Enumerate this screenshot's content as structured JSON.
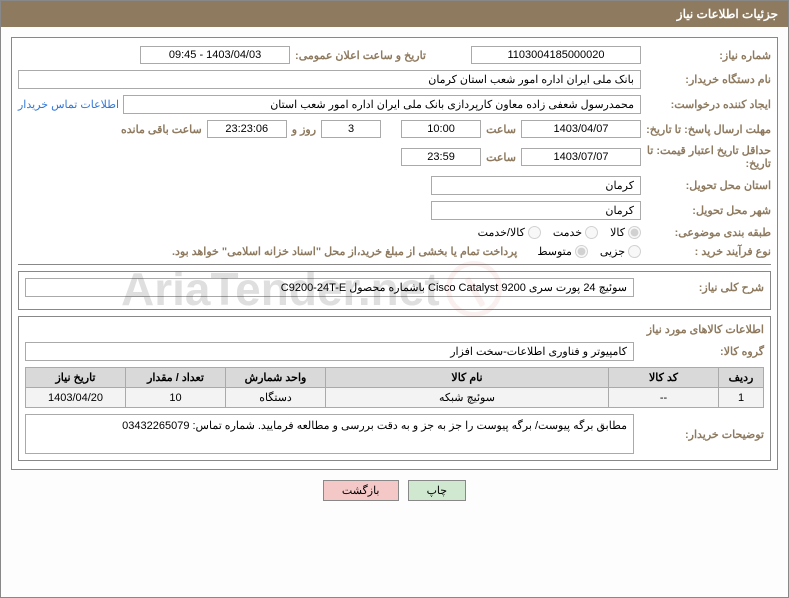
{
  "header": {
    "title": "جزئیات اطلاعات نیاز"
  },
  "fields": {
    "need_no_label": "شماره نیاز:",
    "need_no": "1103004185000020",
    "announce_dt_label": "تاریخ و ساعت اعلان عمومی:",
    "announce_dt": "1403/04/03 - 09:45",
    "buyer_org_label": "نام دستگاه خریدار:",
    "buyer_org": "بانک ملی ایران اداره امور شعب استان کرمان",
    "requester_label": "ایجاد کننده درخواست:",
    "requester": "محمدرسول شعفی زاده معاون کارپردازی بانک ملی ایران اداره امور شعب استان",
    "contact_link": "اطلاعات تماس خریدار",
    "resp_dead_label": "مهلت ارسال پاسخ: تا تاریخ:",
    "resp_date": "1403/04/07",
    "time_lbl": "ساعت",
    "resp_time": "10:00",
    "days_val": "3",
    "days_and_lbl": "روز و",
    "countdown": "23:23:06",
    "remain_lbl": "ساعت باقی مانده",
    "price_valid_label": "حداقل تاریخ اعتبار قیمت: تا تاریخ:",
    "price_date": "1403/07/07",
    "price_time": "23:59",
    "deliv_prov_label": "استان محل تحویل:",
    "deliv_prov": "کرمان",
    "deliv_city_label": "شهر محل تحویل:",
    "deliv_city": "کرمان",
    "class_label": "طبقه بندی موضوعی:",
    "r_kala": "کالا",
    "r_khedmat": "خدمت",
    "r_kx": "کالا/خدمت",
    "buy_proc_label": "نوع فرآیند خرید :",
    "r_jozi": "جزیی",
    "r_motavaset": "متوسط",
    "payment_note": "پرداخت تمام یا بخشی از مبلغ خرید،از محل \"اسناد خزانه اسلامی\" خواهد بود.",
    "desc_need_label": "شرح کلی نیاز:",
    "desc_need": "سوئیچ 24 پورت سری Cisco Catalyst 9200 باشماره محصول C9200-24T-E",
    "goods_info_title": "اطلاعات کالاهای مورد نیاز",
    "goods_group_label": "گروه کالا:",
    "goods_group": "کامپیوتر و فناوری اطلاعات-سخت افزار",
    "buyer_notes_label": "توضیحات خریدار:",
    "buyer_notes": "مطابق برگه پیوست/ برگه پیوست را جز به جز و به دقت بررسی و مطالعه فرمایید. شماره تماس: 03432265079"
  },
  "table": {
    "headers": [
      "ردیف",
      "کد کالا",
      "نام کالا",
      "واحد شمارش",
      "تعداد / مقدار",
      "تاریخ نیاز"
    ],
    "rows": [
      {
        "radif": "1",
        "code": "--",
        "name": "سوئیچ شبکه",
        "unit": "دستگاه",
        "qty": "10",
        "date": "1403/04/20"
      }
    ]
  },
  "buttons": {
    "print": "چاپ",
    "back": "بازگشت"
  },
  "watermark": "AriaTender.net"
}
